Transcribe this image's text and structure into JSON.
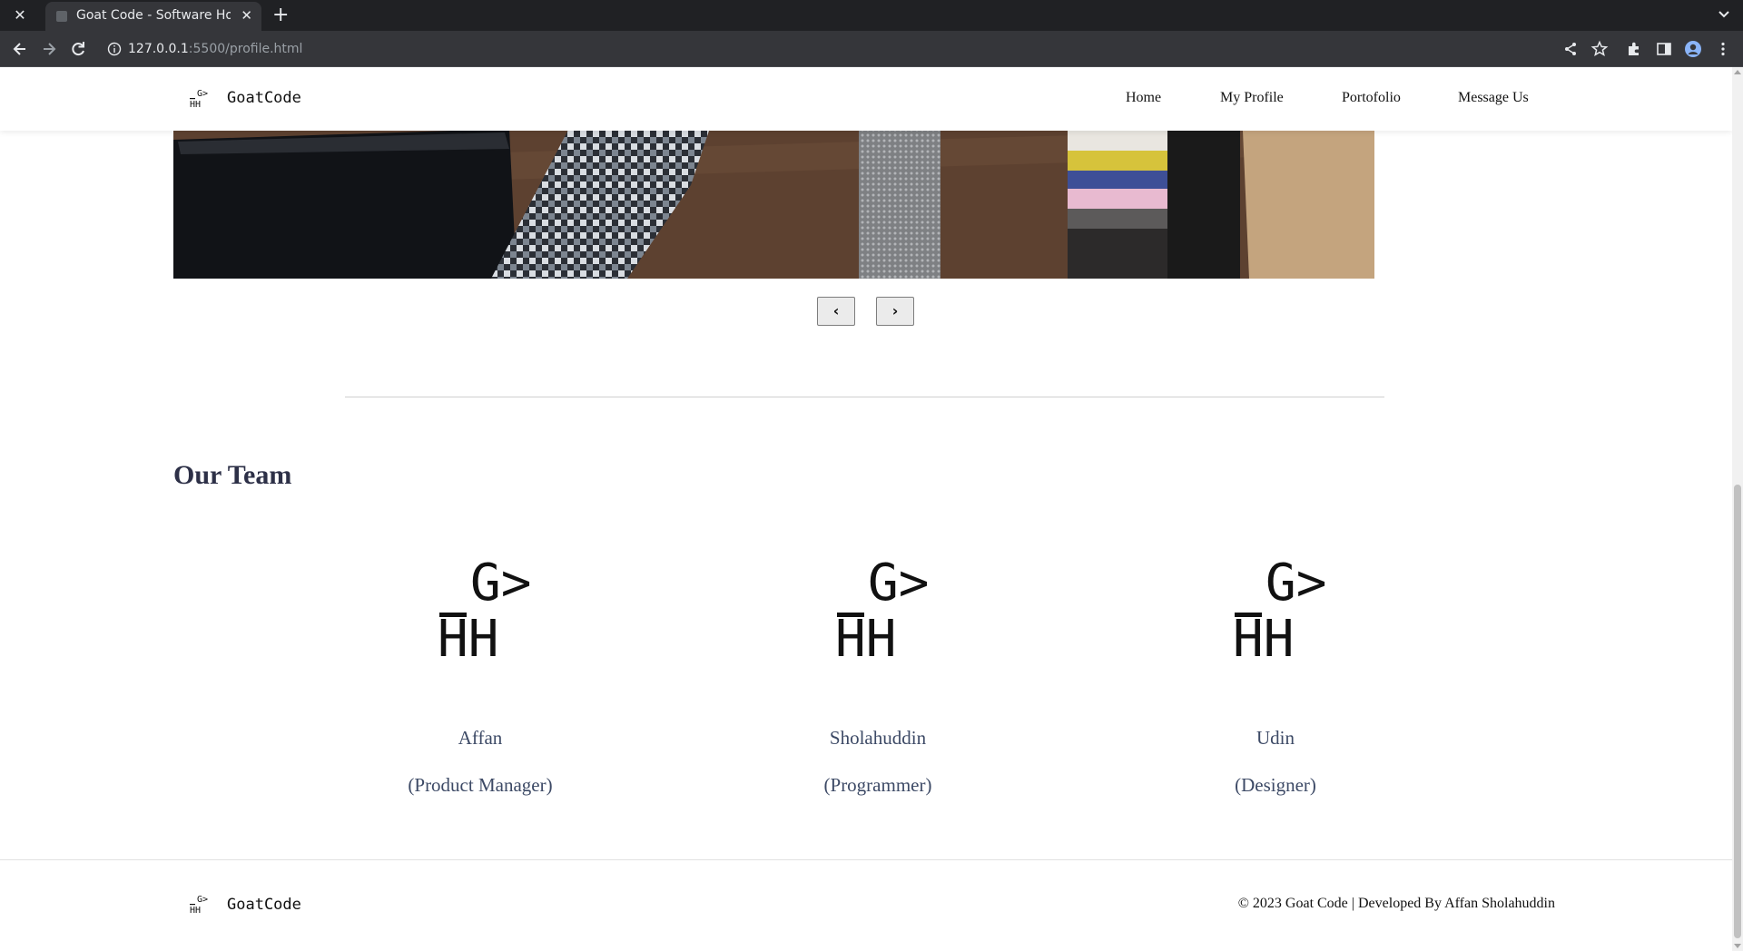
{
  "browser": {
    "tab_title": "Goat Code - Software House",
    "url_host": "127.0.0.1",
    "url_rest": ":5500/profile.html",
    "close_glyph": "✕",
    "new_tab_glyph": "+",
    "tab_close_glyph": "✕"
  },
  "logo": {
    "top": "G>",
    "bottom": "HH",
    "brand_name": "GoatCode"
  },
  "nav": {
    "items": [
      {
        "label": "Home"
      },
      {
        "label": "My Profile"
      },
      {
        "label": "Portofolio"
      },
      {
        "label": "Message Us"
      }
    ]
  },
  "carousel": {
    "prev_label": "‹",
    "next_label": "›"
  },
  "team": {
    "heading": "Our Team",
    "members": [
      {
        "name": "Affan",
        "role": "(Product Manager)"
      },
      {
        "name": "Sholahuddin",
        "role": "(Programmer)"
      },
      {
        "name": "Udin",
        "role": "(Designer)"
      }
    ]
  },
  "footer": {
    "brand_name": "GoatCode",
    "copyright": "© 2023 Goat Code | Developed By Affan Sholahuddin"
  },
  "colors": {
    "chrome_dark": "#202124",
    "chrome_tab": "#35363a",
    "heading": "#2d3047",
    "member_text": "#3d4a66"
  }
}
